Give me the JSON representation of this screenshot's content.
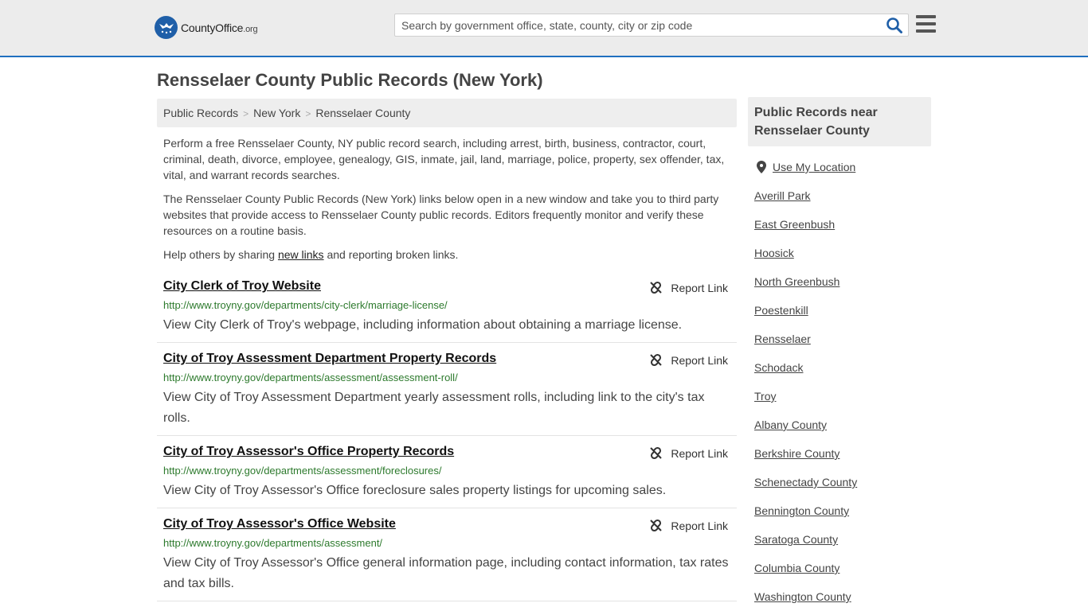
{
  "header": {
    "logo_main": "CountyOffice",
    "logo_suffix": ".org",
    "search_placeholder": "Search by government office, state, county, city or zip code"
  },
  "page_title": "Rensselaer County Public Records (New York)",
  "breadcrumb": [
    "Public Records",
    "New York",
    "Rensselaer County"
  ],
  "intro": {
    "p1": "Perform a free Rensselaer County, NY public record search, including arrest, birth, business, contractor, court, criminal, death, divorce, employee, genealogy, GIS, inmate, jail, land, marriage, police, property, sex offender, tax, vital, and warrant records searches.",
    "p2": "The Rensselaer County Public Records (New York) links below open in a new window and take you to third party websites that provide access to Rensselaer County public records. Editors frequently monitor and verify these resources on a routine basis.",
    "p3_before": "Help others by sharing ",
    "p3_link": "new links",
    "p3_after": " and reporting broken links."
  },
  "report_label": "Report Link",
  "records": [
    {
      "title": "City Clerk of Troy Website",
      "url": "http://www.troyny.gov/departments/city-clerk/marriage-license/",
      "desc": "View City Clerk of Troy's webpage, including information about obtaining a marriage license."
    },
    {
      "title": "City of Troy Assessment Department Property Records",
      "url": "http://www.troyny.gov/departments/assessment/assessment-roll/",
      "desc": "View City of Troy Assessment Department yearly assessment rolls, including link to the city's tax rolls."
    },
    {
      "title": "City of Troy Assessor's Office Property Records",
      "url": "http://www.troyny.gov/departments/assessment/foreclosures/",
      "desc": "View City of Troy Assessor's Office foreclosure sales property listings for upcoming sales."
    },
    {
      "title": "City of Troy Assessor's Office Website",
      "url": "http://www.troyny.gov/departments/assessment/",
      "desc": "View City of Troy Assessor's Office general information page, including contact information, tax rates and tax bills."
    }
  ],
  "sidebar": {
    "heading_line1": "Public Records near",
    "heading_line2": "Rensselaer County",
    "use_location": "Use My Location",
    "links": [
      "Averill Park",
      "East Greenbush",
      "Hoosick",
      "North Greenbush",
      "Poestenkill",
      "Rensselaer",
      "Schodack",
      "Troy",
      "Albany County",
      "Berkshire County",
      "Schenectady County",
      "Bennington County",
      "Saratoga County",
      "Columbia County",
      "Washington County"
    ]
  }
}
